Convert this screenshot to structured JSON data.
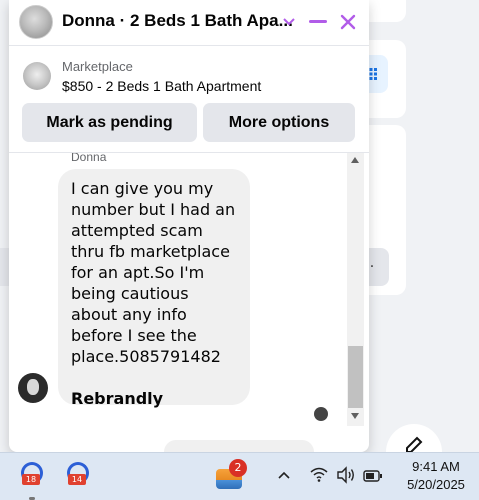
{
  "chat": {
    "title": "Donna · 2 Beds 1 Bath Apa...",
    "listing_source": "Marketplace",
    "listing_name": "$850 - 2 Beds 1 Bath Apartment",
    "mark_pending_label": "Mark as pending",
    "more_options_label": "More options",
    "sender_name": "Donna",
    "message_text": "I can give you my number but I had an attempted scam thru fb marketplace for an apt.So I'm being cautious about any info before I see the place.5085791482",
    "message_link": "Rebrandly"
  },
  "icons": {
    "header": [
      "chevron-down-icon",
      "minimize-icon",
      "close-icon"
    ],
    "accent_color": "#b15ce8"
  },
  "taskbar": {
    "app1_badge": "18",
    "app2_badge": "14",
    "widget_badge": "2",
    "time": "9:41 AM",
    "date": "5/20/2025"
  }
}
